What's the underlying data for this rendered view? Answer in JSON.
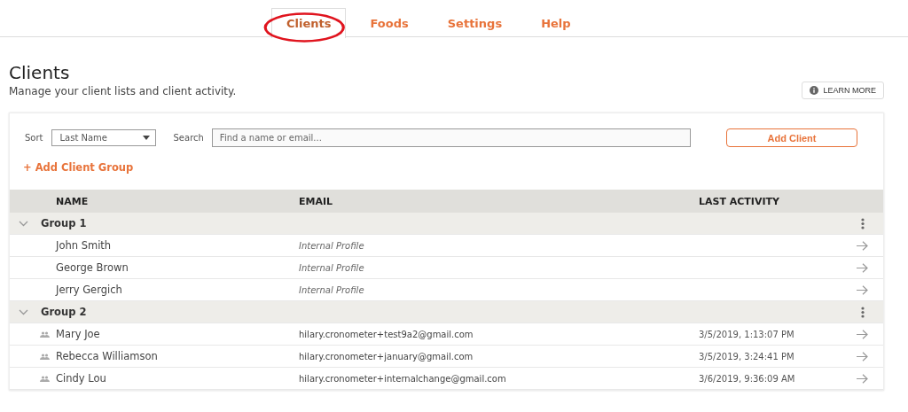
{
  "nav": {
    "tabs": [
      {
        "label": "Clients",
        "selected": true,
        "circled": true
      },
      {
        "label": "Foods",
        "selected": false,
        "circled": false
      },
      {
        "label": "Settings",
        "selected": false,
        "circled": false
      },
      {
        "label": "Help",
        "selected": false,
        "circled": false
      }
    ]
  },
  "header": {
    "title": "Clients",
    "subtitle": "Manage your client lists and client activity.",
    "learn_more": "LEARN MORE"
  },
  "controls": {
    "sort_label": "Sort",
    "sort_value": "Last Name",
    "search_label": "Search",
    "search_placeholder": "Find a name or email...",
    "add_client": "Add Client",
    "add_group": "+ Add Client Group"
  },
  "table": {
    "columns": [
      "NAME",
      "EMAIL",
      "LAST ACTIVITY"
    ],
    "groups": [
      {
        "name": "Group 1",
        "expanded": true,
        "clients": [
          {
            "name": "John Smith",
            "kind": "internal",
            "email": "Internal Profile",
            "linked": false
          },
          {
            "name": "George Brown",
            "kind": "internal",
            "email": "Internal Profile",
            "linked": false
          },
          {
            "name": "Jerry Gergich",
            "kind": "internal",
            "email": "Internal Profile",
            "linked": false
          }
        ]
      },
      {
        "name": "Group 2",
        "expanded": true,
        "clients": [
          {
            "name": "Mary Joe",
            "kind": "email",
            "email": "hilary.cronometer+test9a2@gmail.com",
            "last_activity": "3/5/2019, 1:13:07 PM",
            "linked": true
          },
          {
            "name": "Rebecca Williamson",
            "kind": "email",
            "email": "hilary.cronometer+january@gmail.com",
            "last_activity": "3/5/2019, 3:24:41 PM",
            "linked": true
          },
          {
            "name": "Cindy Lou",
            "kind": "email",
            "email": "hilary.cronometer+internalchange@gmail.com",
            "last_activity": "3/6/2019, 9:36:09 AM",
            "linked": true
          }
        ]
      }
    ]
  }
}
